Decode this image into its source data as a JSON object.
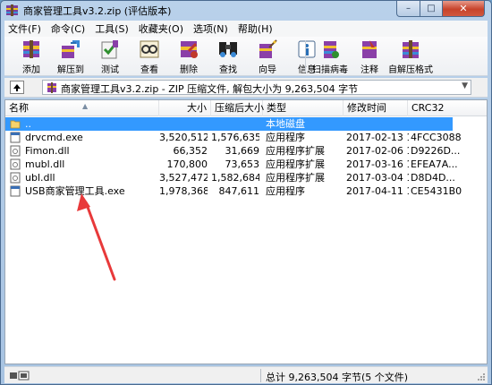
{
  "window": {
    "title": "商家管理工具v3.2.zip (评估版本)",
    "controls": {
      "minimize": "–",
      "maximize": "□",
      "close": "✕"
    }
  },
  "menu": [
    "文件(F)",
    "命令(C)",
    "工具(S)",
    "收藏夹(O)",
    "选项(N)",
    "帮助(H)"
  ],
  "toolbar": [
    {
      "label": "添加",
      "icon": "add-archive-icon"
    },
    {
      "label": "解压到",
      "icon": "extract-to-icon"
    },
    {
      "label": "测试",
      "icon": "test-icon"
    },
    {
      "label": "查看",
      "icon": "view-icon"
    },
    {
      "label": "删除",
      "icon": "delete-icon"
    },
    {
      "label": "查找",
      "icon": "find-icon"
    },
    {
      "label": "向导",
      "icon": "wizard-icon"
    },
    {
      "label": "信息",
      "icon": "info-icon"
    },
    {
      "label": "扫描病毒",
      "icon": "virus-scan-icon"
    },
    {
      "label": "注释",
      "icon": "comment-icon"
    },
    {
      "label": "自解压格式",
      "icon": "sfx-icon"
    }
  ],
  "address": {
    "path": "商家管理工具v3.2.zip - ZIP 压缩文件, 解包大小为 9,263,504 字节"
  },
  "columns": [
    "名称",
    "大小",
    "压缩后大小",
    "类型",
    "修改时间",
    "CRC32"
  ],
  "rows": [
    {
      "name": "..",
      "size": "",
      "packed": "",
      "type": "本地磁盘",
      "modified": "",
      "crc": "",
      "selected": true,
      "icon": "folder-up-icon"
    },
    {
      "name": "drvcmd.exe",
      "size": "3,520,512",
      "packed": "1,576,635",
      "type": "应用程序",
      "modified": "2017-02-13 1...",
      "crc": "4FCC3088",
      "selected": false,
      "icon": "exe-file-icon"
    },
    {
      "name": "Fimon.dll",
      "size": "66,352",
      "packed": "31,669",
      "type": "应用程序扩展",
      "modified": "2017-02-06 1...",
      "crc": "D9226D...",
      "selected": false,
      "icon": "dll-file-icon"
    },
    {
      "name": "mubl.dll",
      "size": "170,800",
      "packed": "73,653",
      "type": "应用程序扩展",
      "modified": "2017-03-16 1...",
      "crc": "EFEA7A...",
      "selected": false,
      "icon": "dll-file-icon"
    },
    {
      "name": "ubl.dll",
      "size": "3,527,472",
      "packed": "1,582,684",
      "type": "应用程序扩展",
      "modified": "2017-03-04 1...",
      "crc": "D8D4D...",
      "selected": false,
      "icon": "dll-file-icon"
    },
    {
      "name": "USB商家管理工具.exe",
      "size": "1,978,368",
      "packed": "847,611",
      "type": "应用程序",
      "modified": "2017-04-11 1...",
      "crc": "CE5431B0",
      "selected": false,
      "icon": "exe-file-icon"
    }
  ],
  "status": {
    "summary": "总计 9,263,504 字节(5 个文件)"
  },
  "colors": {
    "selection": "#3399ff",
    "annotation_arrow": "#e8393a",
    "close_button": "#c7432b"
  }
}
